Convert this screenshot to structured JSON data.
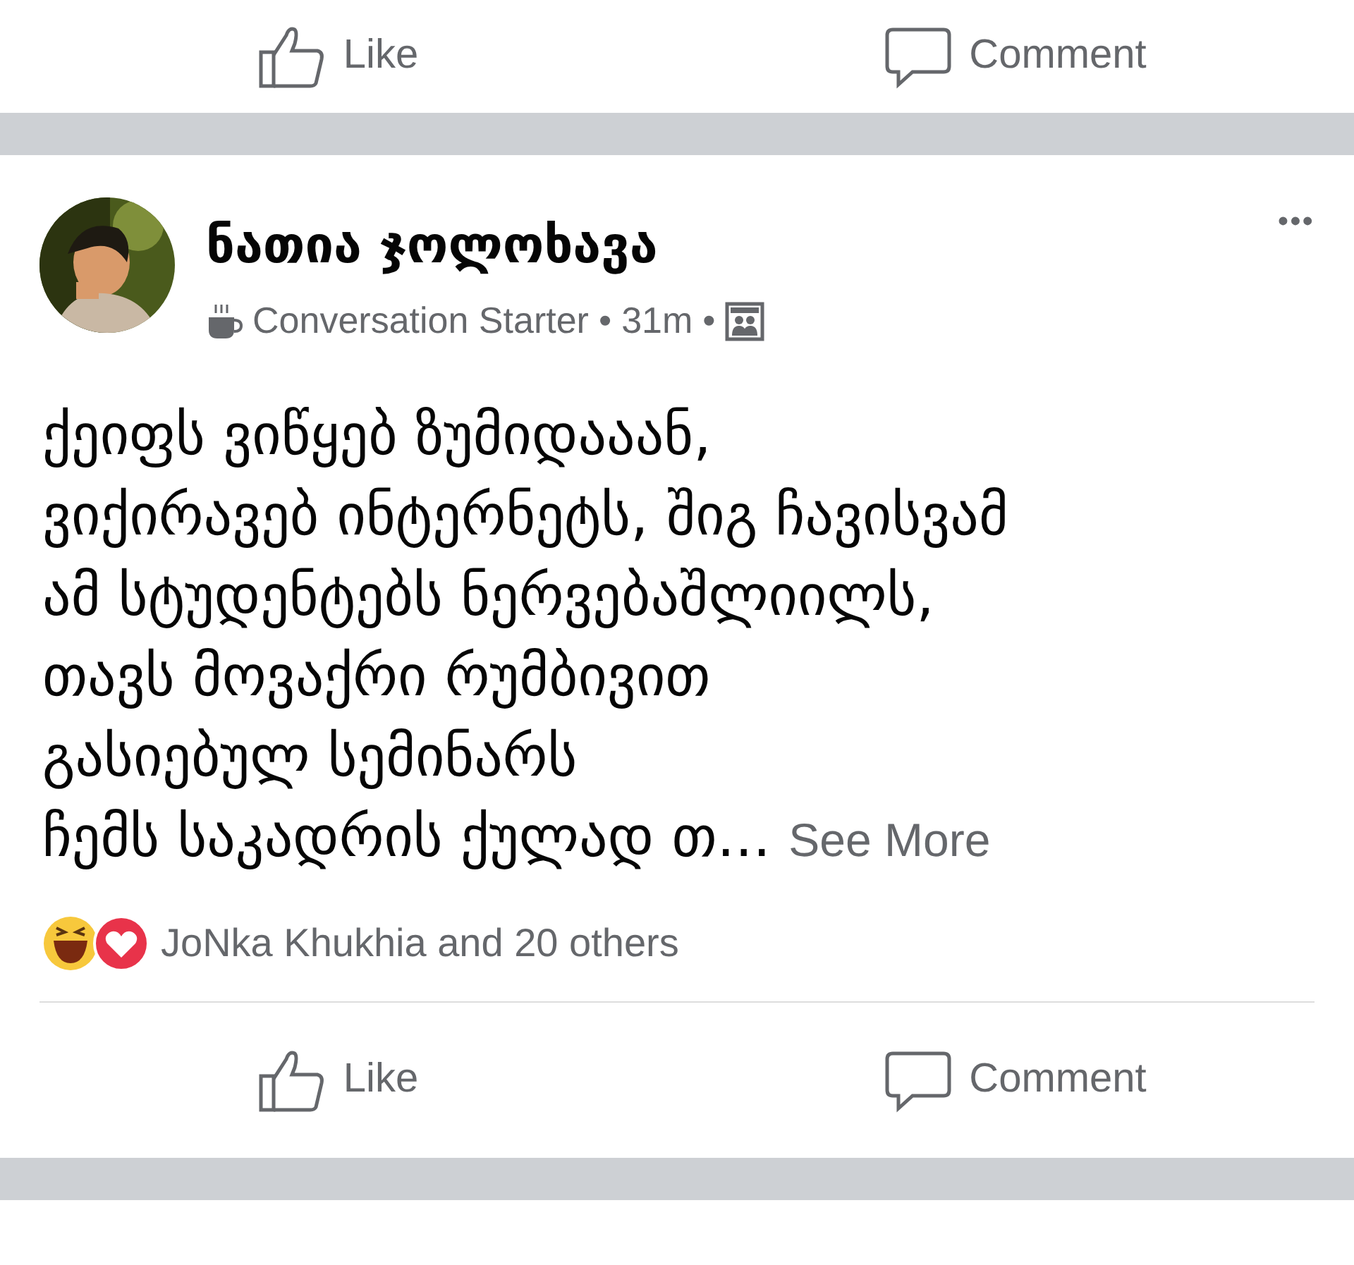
{
  "top_actions": [
    {
      "kind": "like",
      "label": "Like"
    },
    {
      "kind": "comment",
      "label": "Comment"
    }
  ],
  "post": {
    "author": "ნათია ჯოლოხავა",
    "badge": "Conversation Starter",
    "separator": "•",
    "time": "31m",
    "body_lines": [
      "ქეიფს ვიწყებ ზუმიდააან,",
      "ვიქირავებ ინტერნეტს, შიგ ჩავისვამ",
      "ამ სტუდენტებს ნერვებაშლიილს,",
      "თავს მოვაქრი რუმბივით",
      "გასიებულ სემინარს",
      "ჩემს საკადრის ქულად თ..."
    ],
    "see_more": "See More",
    "reactions_text": "JoNka Khukhia and 20 others",
    "menu": "•••"
  },
  "bottom_actions": [
    {
      "kind": "like",
      "label": "Like"
    },
    {
      "kind": "comment",
      "label": "Comment"
    }
  ]
}
